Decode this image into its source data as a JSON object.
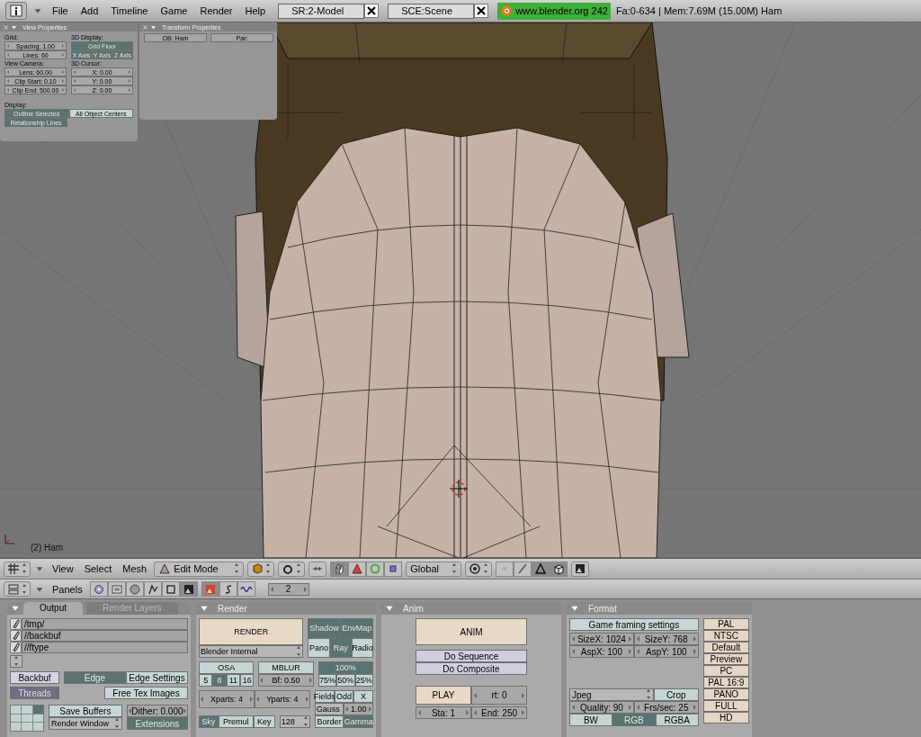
{
  "top_bar": {
    "menus": [
      "File",
      "Add",
      "Timeline",
      "Game",
      "Render",
      "Help"
    ],
    "screen": "SR:2-Model",
    "scene": "SCE:Scene",
    "version": "www.blender.org 242",
    "stats": "Fa:0-634 | Mem:7.69M (15.00M) Ham"
  },
  "viewport": {
    "object_label": "(2) Ham",
    "panels": [
      {
        "title": "View Properties",
        "body": {
          "rows": [
            [
              {
                "rows": [
                  [
                    {
                      "kind": "label",
                      "label": "Grid:"
                    }
                  ],
                  [
                    {
                      "kind": "num",
                      "label": "Spacing: 1.00"
                    }
                  ],
                  [
                    {
                      "kind": "num",
                      "label": "Lines: 60"
                    }
                  ],
                  [
                    {
                      "kind": "label",
                      "label": "View Camera:"
                    }
                  ],
                  [
                    {
                      "kind": "num",
                      "label": "Lens: 60.00"
                    }
                  ],
                  [
                    {
                      "kind": "num",
                      "label": "Clip Start: 0.10"
                    }
                  ],
                  [
                    {
                      "kind": "num",
                      "label": "Clip End: 500.00"
                    }
                  ]
                ]
              },
              {
                "rows": [
                  [
                    {
                      "kind": "label",
                      "label": "3D Display:"
                    }
                  ],
                  [
                    {
                      "kind": "toggle",
                      "label": "Grid Floor",
                      "selected": true
                    }
                  ],
                  [
                    {
                      "kind": "toggle",
                      "label": "X Axis",
                      "selected": true
                    },
                    {
                      "kind": "toggle",
                      "label": "Y Axis",
                      "selected": true
                    },
                    {
                      "kind": "toggle",
                      "label": "Z Axis",
                      "selected": true
                    }
                  ],
                  [
                    {
                      "kind": "label",
                      "label": "3D Cursor:"
                    }
                  ],
                  [
                    {
                      "kind": "num",
                      "label": "X: 0.00"
                    }
                  ],
                  [
                    {
                      "kind": "num",
                      "label": "Y: 0.00"
                    }
                  ],
                  [
                    {
                      "kind": "num",
                      "label": "Z: 0.00"
                    }
                  ]
                ]
              }
            ],
            [
              {
                "kind": "label",
                "label": "Display:"
              }
            ],
            [
              {
                "kind": "toggle",
                "label": "Outline Selected",
                "selected": true
              },
              {
                "kind": "toggle",
                "label": "All Object Centers",
                "selected": false
              }
            ],
            [
              {
                "kind": "toggle",
                "label": "Relationship Lines",
                "selected": true
              }
            ]
          ]
        }
      },
      {
        "title": "Transform Properties",
        "body": {
          "rows": [
            [
              {
                "kind": "text",
                "label": "OB: Ham"
              },
              {
                "kind": "text",
                "label": "Par:"
              }
            ]
          ]
        }
      }
    ]
  },
  "view3d_header": {
    "menus": [
      "View",
      "Select",
      "Mesh"
    ],
    "mode": "Edit Mode",
    "orientation": "Global",
    "manipulators": [
      {
        "selected": true
      },
      {
        "selected": false
      },
      {
        "selected": false
      },
      {
        "selected": false
      }
    ],
    "select_modes": [
      {
        "selected": false
      },
      {
        "selected": false
      },
      {
        "selected": true
      }
    ],
    "occlude": {
      "selected": true
    }
  },
  "buttons_header": {
    "label": "Panels",
    "contexts": [
      {
        "selected": false
      },
      {
        "selected": false
      },
      {
        "selected": false
      },
      {
        "selected": false
      },
      {
        "selected": false
      },
      {
        "selected": true
      }
    ],
    "subcontexts": [
      {
        "selected": true
      },
      {
        "selected": false
      },
      {
        "selected": false
      }
    ],
    "frame": "2"
  },
  "panels": [
    {
      "tabs": [
        {
          "label": "Output",
          "selected": true
        },
        {
          "label": "Render Layers",
          "selected": false
        }
      ],
      "body": {
        "rows": [
          [
            {
              "kind": "path",
              "label": "/tmp/"
            }
          ],
          [
            {
              "kind": "path",
              "label": "//backbuf"
            }
          ],
          [
            {
              "kind": "path",
              "label": "//ftype"
            }
          ],
          [
            {
              "kind": "iconmenu"
            }
          ],
          [
            {
              "kind": "option",
              "label": "Backbuf",
              "selected": false
            },
            {
              "rows": [
                [
                  {
                    "kind": "toggle",
                    "label": "Edge",
                    "selected": true
                  },
                  {
                    "kind": "action",
                    "label": "Edge Settings"
                  }
                ]
              ]
            }
          ],
          [
            {
              "kind": "option",
              "label": "Threads",
              "selected": true
            },
            {
              "kind": "action",
              "label": "Free Tex Images"
            }
          ],
          [
            {
              "kind": "grid"
            },
            {
              "rows": [
                [
                  {
                    "kind": "action",
                    "label": "Save Buffers"
                  }
                ],
                [
                  {
                    "kind": "menu",
                    "label": "Render Window"
                  }
                ]
              ]
            },
            {
              "rows": [
                [
                  {
                    "kind": "num",
                    "label": "Dither: 0.000"
                  }
                ],
                [
                  {
                    "kind": "toggle",
                    "label": "Extensions",
                    "selected": true
                  }
                ]
              ]
            }
          ]
        ]
      }
    },
    {
      "title": "Render",
      "body": {
        "rows": [
          [
            {
              "rows": [
                [
                  {
                    "kind": "big",
                    "label": "RENDER"
                  }
                ],
                [
                  {
                    "kind": "menu",
                    "label": "Blender Internal"
                  }
                ]
              ]
            },
            {
              "rows": [
                [
                  {
                    "kind": "toggle",
                    "label": "Shadow",
                    "selected": true
                  },
                  {
                    "kind": "toggle",
                    "label": "EnvMap",
                    "selected": true
                  }
                ],
                [
                  {
                    "kind": "toggle",
                    "label": "Pano",
                    "selected": false
                  },
                  {
                    "kind": "toggle",
                    "label": "Ray",
                    "selected": true
                  },
                  {
                    "kind": "toggle",
                    "label": "Radio",
                    "selected": false
                  }
                ]
              ]
            }
          ],
          [
            {
              "rows": [
                [
                  {
                    "kind": "toggle",
                    "label": "OSA",
                    "selected": false
                  }
                ],
                [
                  {
                    "rows": [
                      [
                        {
                          "kind": "toggle",
                          "label": "5",
                          "selected": false
                        },
                        {
                          "kind": "toggle",
                          "label": "8",
                          "selected": true
                        },
                        {
                          "kind": "toggle",
                          "label": "11",
                          "selected": false
                        },
                        {
                          "kind": "toggle",
                          "label": "16",
                          "selected": false
                        }
                      ]
                    ]
                  }
                ]
              ]
            },
            {
              "rows": [
                [
                  {
                    "kind": "toggle",
                    "label": "MBLUR",
                    "selected": false
                  }
                ],
                [
                  {
                    "kind": "num",
                    "label": "Bf: 0.50"
                  }
                ]
              ]
            },
            {
              "rows": [
                [
                  {
                    "kind": "toggle",
                    "label": "100%",
                    "selected": true
                  }
                ],
                [
                  {
                    "rows": [
                      [
                        {
                          "kind": "toggle",
                          "label": "75%",
                          "selected": false
                        },
                        {
                          "kind": "toggle",
                          "label": "50%",
                          "selected": false
                        },
                        {
                          "kind": "toggle",
                          "label": "25%",
                          "selected": false
                        }
                      ]
                    ]
                  }
                ]
              ]
            }
          ],
          [
            {
              "rows": [
                [
                  {
                    "kind": "num",
                    "label": "Xparts: 4"
                  },
                  {
                    "kind": "num",
                    "label": "Yparts: 4"
                  }
                ],
                [
                  {
                    "rows": [
                      [
                        {
                          "kind": "toggle",
                          "label": "Sky",
                          "selected": true
                        },
                        {
                          "kind": "toggle",
                          "label": "Premul",
                          "selected": false
                        },
                        {
                          "kind": "toggle",
                          "label": "Key",
                          "selected": false
                        }
                      ]
                    ]
                  },
                  {
                    "kind": "menu",
                    "label": "128"
                  }
                ]
              ]
            },
            {
              "rows": [
                [
                  {
                    "kind": "toggle",
                    "label": "Fields",
                    "selected": false
                  },
                  {
                    "kind": "toggle",
                    "label": "Odd",
                    "selected": false
                  },
                  {
                    "kind": "toggle",
                    "label": "X",
                    "selected": false
                  }
                ],
                [
                  {
                    "kind": "menu",
                    "label": "Gauss"
                  },
                  {
                    "kind": "num",
                    "label": "1.00"
                  }
                ],
                [
                  {
                    "kind": "toggle",
                    "label": "Border",
                    "selected": false
                  },
                  {
                    "kind": "toggle",
                    "label": "Gamma",
                    "selected": true
                  }
                ]
              ]
            }
          ]
        ]
      }
    },
    {
      "title": "Anim",
      "body": {
        "rows": [
          [
            {
              "kind": "big",
              "label": "ANIM"
            }
          ],
          [
            {
              "kind": "action2",
              "label": "Do Sequence"
            }
          ],
          [
            {
              "kind": "action2",
              "label": "Do Composite"
            }
          ],
          [
            {
              "kind": "big",
              "label": "PLAY"
            },
            {
              "kind": "num",
              "label": "rt: 0"
            }
          ],
          [
            {
              "kind": "num",
              "label": "Sta: 1"
            },
            {
              "kind": "num",
              "label": "End: 250"
            }
          ]
        ]
      }
    },
    {
      "title": "Format",
      "body": {
        "rows": [
          [
            {
              "rows": [
                [
                  {
                    "kind": "action",
                    "label": "Game framing settings"
                  }
                ],
                [
                  {
                    "kind": "num",
                    "label": "SizeX: 1024"
                  },
                  {
                    "kind": "num",
                    "label": "SizeY: 768"
                  }
                ],
                [
                  {
                    "kind": "num",
                    "label": "AspX: 100"
                  },
                  {
                    "kind": "num",
                    "label": "AspY: 100"
                  }
                ],
                [
                  {
                    "kind": "menu",
                    "label": "Jpeg"
                  },
                  {
                    "kind": "toggle",
                    "label": "Crop",
                    "selected": false
                  }
                ],
                [
                  {
                    "kind": "num",
                    "label": "Quality: 90"
                  },
                  {
                    "kind": "num",
                    "label": "Frs/sec: 25"
                  }
                ],
                [
                  {
                    "kind": "toggle",
                    "label": "BW",
                    "selected": false
                  },
                  {
                    "kind": "toggle",
                    "label": "RGB",
                    "selected": true
                  },
                  {
                    "kind": "toggle",
                    "label": "RGBA",
                    "selected": false
                  }
                ]
              ]
            },
            {
              "rows": [
                [
                  {
                    "kind": "preset",
                    "label": "PAL"
                  }
                ],
                [
                  {
                    "kind": "preset",
                    "label": "NTSC"
                  }
                ],
                [
                  {
                    "kind": "preset",
                    "label": "Default"
                  }
                ],
                [
                  {
                    "kind": "preset",
                    "label": "Preview"
                  }
                ],
                [
                  {
                    "kind": "preset",
                    "label": "PC"
                  }
                ],
                [
                  {
                    "kind": "preset",
                    "label": "PAL 16:9"
                  }
                ],
                [
                  {
                    "kind": "preset",
                    "label": "PANO"
                  }
                ],
                [
                  {
                    "kind": "preset",
                    "label": "FULL"
                  }
                ],
                [
                  {
                    "kind": "preset",
                    "label": "HD"
                  }
                ]
              ]
            }
          ]
        ]
      }
    }
  ]
}
